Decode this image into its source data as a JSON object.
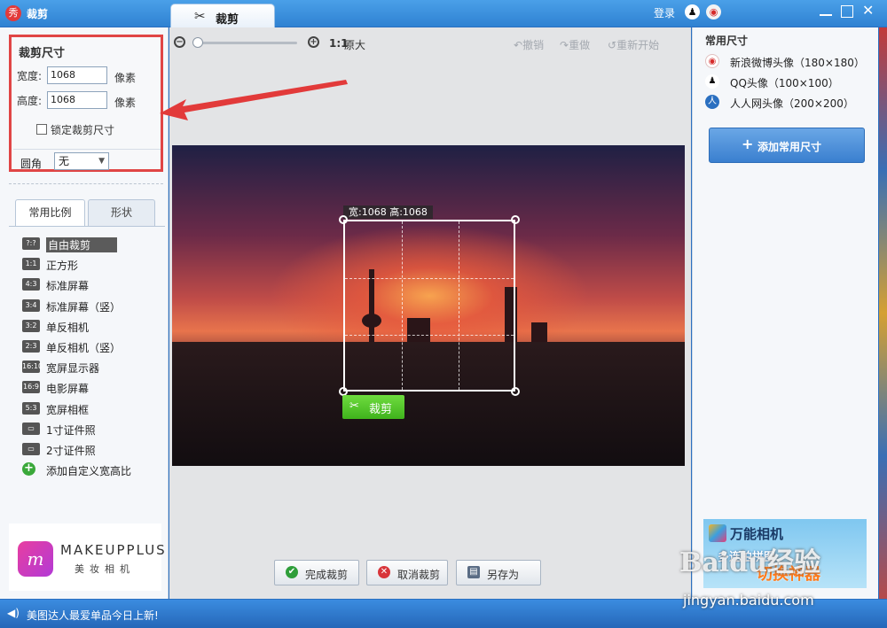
{
  "titlebar": {
    "app_title": "裁剪",
    "app_logo": "秀",
    "tab_label": "裁剪",
    "login": "登录",
    "colors": {
      "bar": "#2f82d2"
    }
  },
  "size_panel": {
    "title": "裁剪尺寸",
    "width_label": "宽度:",
    "width_value": "1068",
    "height_label": "高度:",
    "height_value": "1068",
    "unit": "像素",
    "lock_label": "锁定裁剪尺寸",
    "corner_label": "圆角",
    "corner_value": "无"
  },
  "ratio_tabs": {
    "common": "常用比例",
    "shape": "形状"
  },
  "ratios": [
    {
      "icon": "?:?",
      "label": "自由裁剪",
      "active": true
    },
    {
      "icon": "1:1",
      "label": "正方形"
    },
    {
      "icon": "4:3",
      "label": "标准屏幕"
    },
    {
      "icon": "3:4",
      "label": "标准屏幕（竖）"
    },
    {
      "icon": "3:2",
      "label": "单反相机"
    },
    {
      "icon": "2:3",
      "label": "单反相机（竖）"
    },
    {
      "icon": "16:10",
      "label": "宽屏显示器"
    },
    {
      "icon": "16:9",
      "label": "电影屏幕"
    },
    {
      "icon": "5:3",
      "label": "宽屏相框"
    },
    {
      "icon": "id-card-icon",
      "label": "1寸证件照"
    },
    {
      "icon": "id-card-icon",
      "label": "2寸证件照"
    }
  ],
  "add_custom_ratio": "添加自定义宽高比",
  "ad_left": {
    "logo": "m",
    "brand": "MAKEUPPLUS",
    "sub": "美妆相机"
  },
  "toolbar": {
    "ratio": "1:1",
    "original": "原大",
    "undo": "撤销",
    "redo": "重做",
    "restart": "重新开始",
    "zoom_level": 0
  },
  "crop": {
    "dims_label": "宽:1068 高:1068",
    "crop_button": "裁剪"
  },
  "actions": {
    "finish": "完成裁剪",
    "cancel": "取消裁剪",
    "save_as": "另存为"
  },
  "presets": {
    "title": "常用尺寸",
    "items": [
      {
        "icon": "weibo-icon",
        "label": "新浪微博头像（180×180）"
      },
      {
        "icon": "qq-icon",
        "label": "QQ头像（100×100）"
      },
      {
        "icon": "renren-icon",
        "label": "人人网头像（200×200）"
      }
    ],
    "add_button": "添加常用尺寸"
  },
  "ad_right": {
    "title": "万能相机",
    "line2": "多连拍拼图",
    "line3": "切换神器"
  },
  "statusbar": {
    "text": "美图达人最爱单品今日上新!"
  },
  "watermark": {
    "logo": "Baidu经验",
    "url": "jingyan.baidu.com"
  }
}
